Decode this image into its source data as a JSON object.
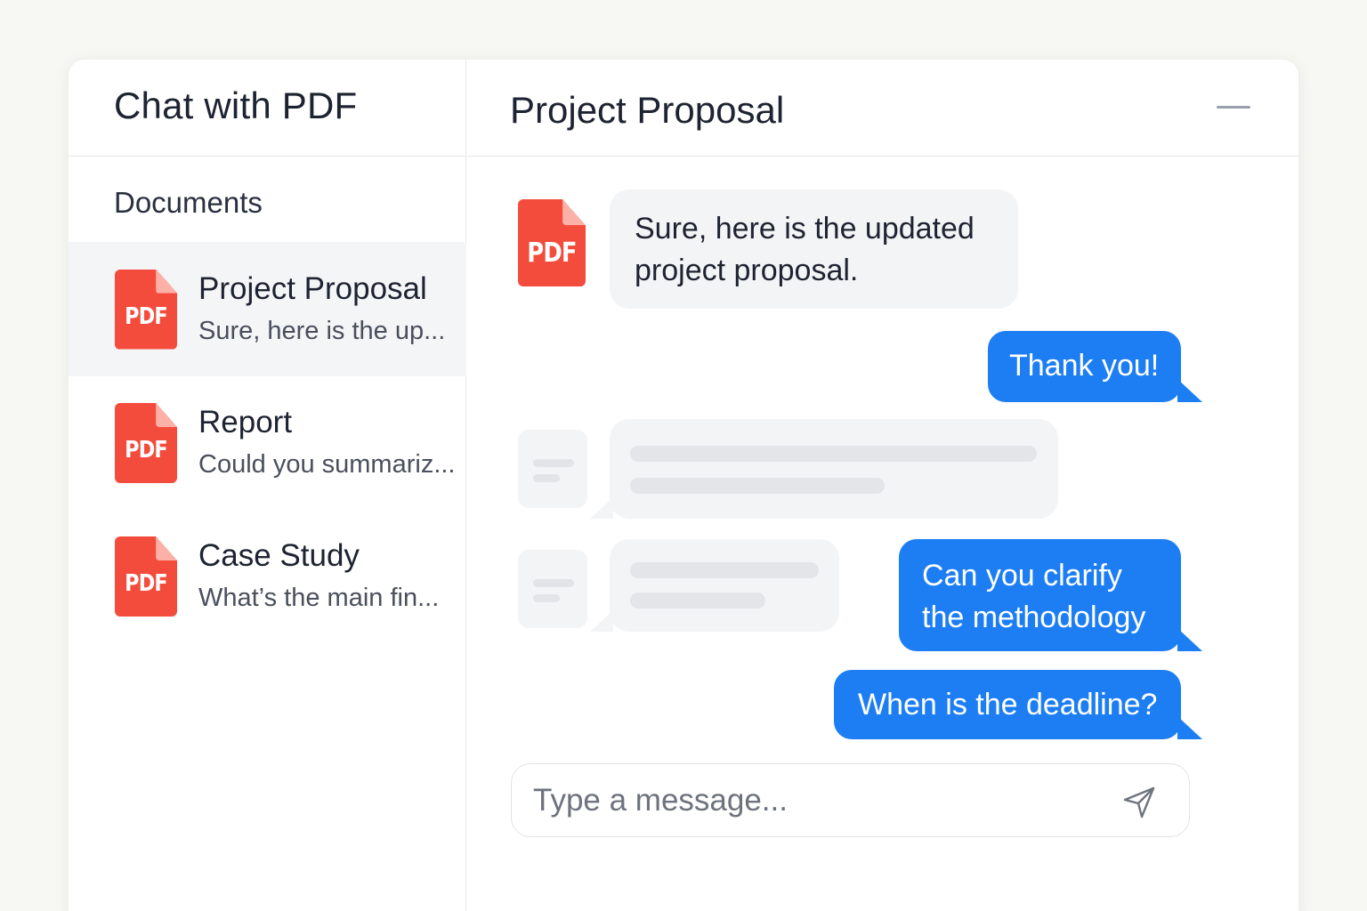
{
  "sidebar": {
    "app_title": "Chat with PDF",
    "section_label": "Documents",
    "documents": [
      {
        "name": "Project Proposal",
        "preview": "Sure, here is the up...",
        "icon": "pdf-icon",
        "active": true
      },
      {
        "name": "Report",
        "preview": "Could you summariz...",
        "icon": "pdf-icon",
        "active": false
      },
      {
        "name": "Case Study",
        "preview": "What’s the main fin...",
        "icon": "pdf-icon",
        "active": false
      }
    ]
  },
  "chat": {
    "title": "Project Proposal",
    "minimize_icon": "minimize-icon",
    "pdf_label": "PDF",
    "messages": [
      {
        "direction": "incoming",
        "text_line1": "Sure, here is the updated",
        "text_line2": "project proposal."
      },
      {
        "direction": "outgoing",
        "text": "Thank you!"
      },
      {
        "direction": "incoming",
        "placeholder": true
      },
      {
        "direction": "incoming",
        "placeholder": true
      },
      {
        "direction": "outgoing",
        "text_line1": "Can you clarify",
        "text_line2": "the methodology"
      },
      {
        "direction": "outgoing",
        "text": "When is the deadline?"
      }
    ],
    "composer": {
      "placeholder": "Type a message...",
      "send_icon": "send-icon"
    }
  },
  "colors": {
    "accent": "#1d7ef3",
    "pdf_red": "#f44c3c",
    "background": "#f7f7f3",
    "incoming_bubble": "#f3f4f6"
  }
}
